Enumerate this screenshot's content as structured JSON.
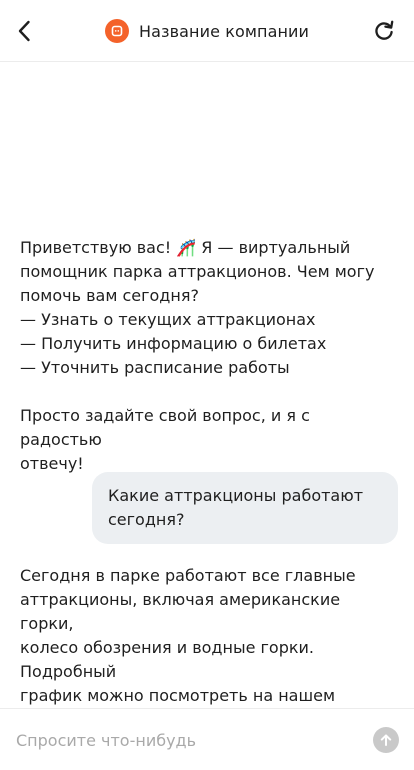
{
  "header": {
    "title": "Название компании",
    "back_icon": "chevron-left-icon",
    "logo_icon": "brand-logo-icon",
    "refresh_icon": "refresh-icon",
    "brand_color": "#f4622a"
  },
  "messages": [
    {
      "role": "assistant",
      "paragraphs": [
        [
          "Приветствую вас! 🎢 Я — виртуальный",
          "помощник парка аттракционов. Чем могу",
          "помочь вам сегодня?",
          "— Узнать о текущих аттракционах",
          "— Получить информацию о билетах",
          "— Уточнить расписание работы"
        ],
        [
          "Просто задайте свой вопрос, и я с радостью",
          "отвечу!"
        ]
      ]
    },
    {
      "role": "user",
      "lines": [
        "Какие аттракционы работают",
        "сегодня?"
      ]
    },
    {
      "role": "assistant",
      "paragraphs": [
        [
          "Сегодня в парке работают все главные",
          "аттракционы, включая американские горки,",
          "колесо обозрения и водные горки. Подробный",
          "график можно посмотреть на нашем сайте."
        ]
      ]
    }
  ],
  "composer": {
    "placeholder": "Спросите что-нибудь",
    "value": "",
    "send_icon": "arrow-up-icon",
    "send_color": "#c9c9c9"
  }
}
